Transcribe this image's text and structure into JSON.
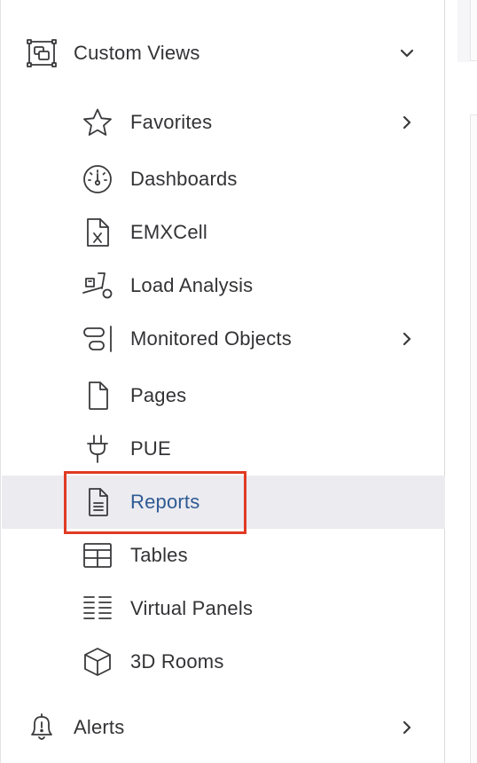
{
  "sidebar": {
    "group": {
      "label": "Custom Views",
      "icon": "custom-views-icon",
      "expanded": true
    },
    "items": [
      {
        "label": "Favorites",
        "icon": "star-icon",
        "has_submenu": true
      },
      {
        "label": "Dashboards",
        "icon": "gauge-icon",
        "has_submenu": false
      },
      {
        "label": "EMXCell",
        "icon": "spreadsheet-file-icon",
        "has_submenu": false
      },
      {
        "label": "Load Analysis",
        "icon": "hand-truck-icon",
        "has_submenu": false
      },
      {
        "label": "Monitored Objects",
        "icon": "monitored-objects-icon",
        "has_submenu": true
      },
      {
        "label": "Pages",
        "icon": "page-icon",
        "has_submenu": false
      },
      {
        "label": "PUE",
        "icon": "plug-icon",
        "has_submenu": false
      },
      {
        "label": "Reports",
        "icon": "report-icon",
        "has_submenu": false,
        "selected": true
      },
      {
        "label": "Tables",
        "icon": "table-icon",
        "has_submenu": false
      },
      {
        "label": "Virtual Panels",
        "icon": "virtual-panels-icon",
        "has_submenu": false
      },
      {
        "label": "3D Rooms",
        "icon": "cube-icon",
        "has_submenu": false
      }
    ],
    "alerts": {
      "label": "Alerts",
      "icon": "bell-icon",
      "has_submenu": true
    }
  },
  "colors": {
    "text": "#333336",
    "selected_text": "#2e5a93",
    "selected_bg": "#ebebf0",
    "highlight_border": "#e03b24",
    "icon_stroke": "#3a3a3d"
  }
}
